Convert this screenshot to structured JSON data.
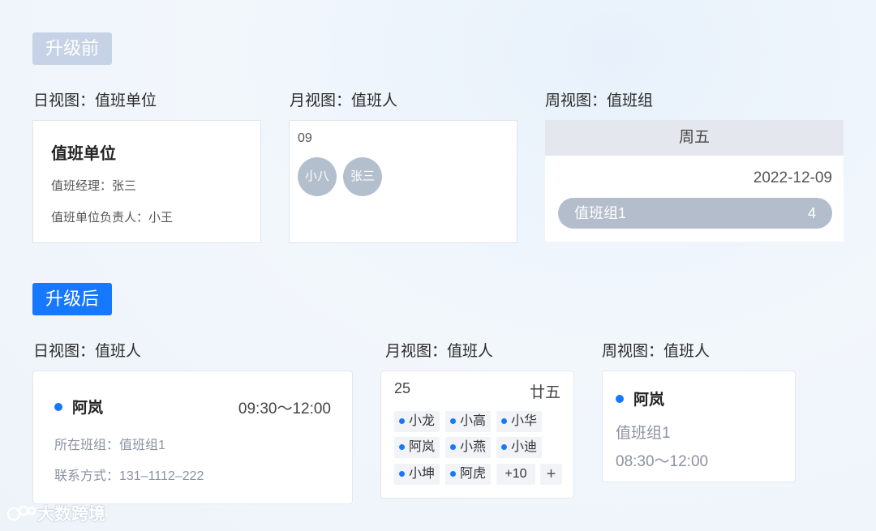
{
  "before": {
    "badge": "升级前",
    "day": {
      "label": "日视图：值班单位",
      "title": "值班单位",
      "manager": "值班经理：张三",
      "owner": "值班单位负责人：小王"
    },
    "month": {
      "label": "月视图：值班人",
      "date": "09",
      "avatars": [
        "小八",
        "张三"
      ]
    },
    "week": {
      "label": "周视图：值班组",
      "weekday": "周五",
      "date": "2022-12-09",
      "group": "值班组1",
      "count": "4"
    }
  },
  "after": {
    "badge": "升级后",
    "day": {
      "label": "日视图：值班人",
      "person": "阿岚",
      "time": "09:30～12:00",
      "group": "所在班组：值班组1",
      "contact": "联系方式：131–1112–222"
    },
    "month": {
      "label": "月视图：值班人",
      "date": "25",
      "lunar": "廿五",
      "people": [
        "小龙",
        "小高",
        "小华",
        "阿岚",
        "小燕",
        "小迪",
        "小坤",
        "阿虎"
      ],
      "more": "+10",
      "add": "+"
    },
    "week": {
      "label": "周视图：值班人",
      "person": "阿岚",
      "group": "值班组1",
      "time": "08:30～12:00"
    }
  },
  "watermark": "大数跨境",
  "colors": {
    "accent": "#1677ff",
    "badge_before": "#c6d3e6",
    "pill": "#b3bdcb"
  }
}
